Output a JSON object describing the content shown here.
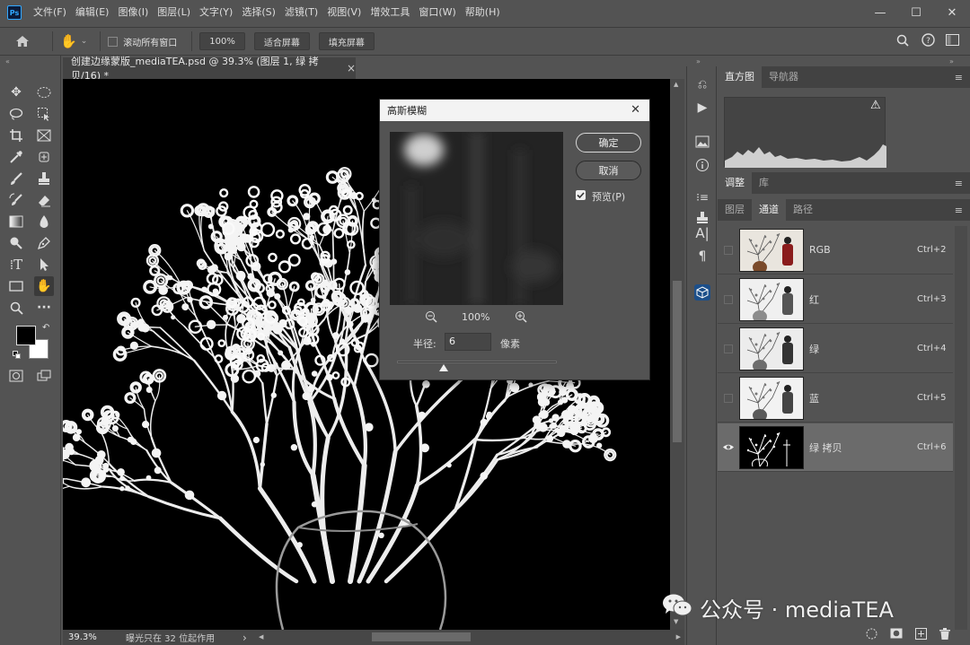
{
  "app": {
    "logo": "Ps"
  },
  "menu": [
    "文件(F)",
    "编辑(E)",
    "图像(I)",
    "图层(L)",
    "文字(Y)",
    "选择(S)",
    "滤镜(T)",
    "视图(V)",
    "增效工具",
    "窗口(W)",
    "帮助(H)"
  ],
  "window_controls": {
    "minimize": "—",
    "maximize": "☐",
    "close": "✕"
  },
  "options": {
    "scroll_all_label": "滚动所有窗口",
    "zoom_value": "100%",
    "fit_screen": "适合屏幕",
    "fill_screen": "填充屏幕"
  },
  "document": {
    "tab_title": "创建边缘蒙版_mediaTEA.psd @ 39.3% (图层 1, 绿 拷贝/16) *",
    "tab_close": "×",
    "zoom": "39.3%",
    "status": "曝光只在 32 位起作用",
    "status_arrow": "›"
  },
  "panels": {
    "top_tabs": [
      "直方图",
      "导航器"
    ],
    "adjust_tabs": [
      "调整",
      "库"
    ],
    "channel_tabs": [
      "图层",
      "通道",
      "路径"
    ],
    "histogram_warning": "⚠",
    "menu_icon": "≡"
  },
  "channels": [
    {
      "name": "RGB",
      "shortcut": "Ctrl+2",
      "visible": false,
      "selected": false
    },
    {
      "name": "红",
      "shortcut": "Ctrl+3",
      "visible": false,
      "selected": false
    },
    {
      "name": "绿",
      "shortcut": "Ctrl+4",
      "visible": false,
      "selected": false
    },
    {
      "name": "蓝",
      "shortcut": "Ctrl+5",
      "visible": false,
      "selected": false
    },
    {
      "name": "绿 拷贝",
      "shortcut": "Ctrl+6",
      "visible": true,
      "selected": true
    }
  ],
  "dialog": {
    "title": "高斯模糊",
    "close": "✕",
    "ok": "确定",
    "cancel": "取消",
    "preview_label": "预览(P)",
    "preview_checked": true,
    "preview_zoom": "100%",
    "radius_label": "半径:",
    "radius_value": "6",
    "radius_unit": "像素",
    "slider_fraction": 0.29
  },
  "watermark": "公众号 · mediaTEA",
  "colors": {
    "accent": "#31a8ff",
    "panel": "#535353",
    "dark": "#424242"
  }
}
